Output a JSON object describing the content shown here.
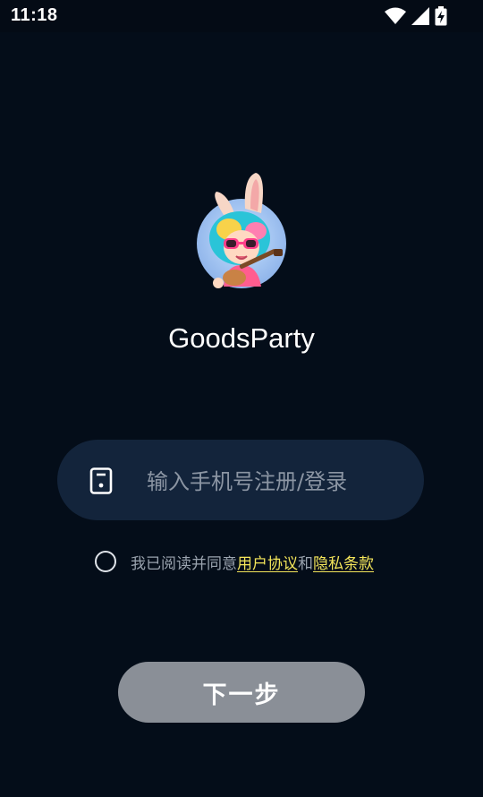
{
  "status_bar": {
    "time": "11:18",
    "icons": [
      "wifi-icon",
      "signal-icon",
      "battery-charging-icon"
    ]
  },
  "app": {
    "name": "GoodsParty",
    "logo": "bunny-ears-girl-guitar-avatar"
  },
  "login": {
    "phone_placeholder": "输入手机号注册/登录",
    "phone_value": "",
    "phone_icon": "phone-icon",
    "agreement_prefix": "我已阅读并同意",
    "user_agreement": "用户协议",
    "and_text": "和",
    "privacy_policy": "隐私条款",
    "agreement_checked": false,
    "next_label": "下一步"
  },
  "colors": {
    "background": "#040d19",
    "field_bg": "#13243b",
    "link": "#f3e55a",
    "button_disabled": "#8a8f97"
  }
}
